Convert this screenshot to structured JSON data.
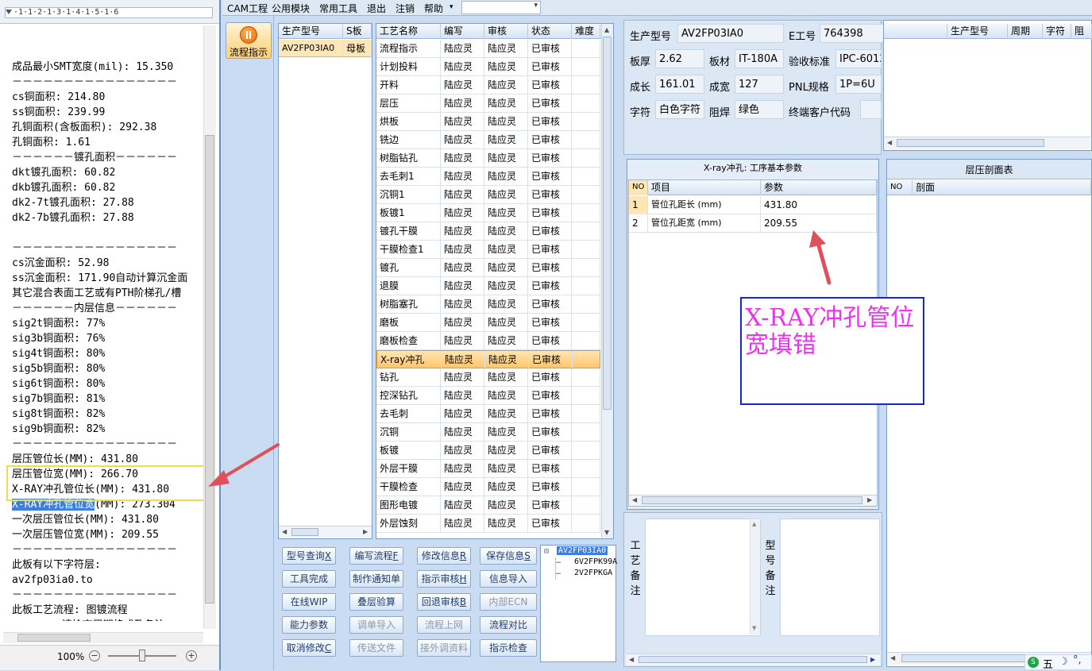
{
  "editor": {
    "ruler": "·1·1·2·1·3·1·4·1·5·1·6",
    "lines": [
      "",
      "成品最小SMT宽度(mil): 15.350",
      "－－－－－－－－－－－－－－－－",
      "cs铜面积: 214.80",
      "ss铜面积: 239.99",
      "孔铜面积(含板面积): 292.38",
      "孔铜面积: 1.61",
      "－－－－－－镀孔面积－－－－－－",
      "dkt镀孔面积: 60.82",
      "dkb镀孔面积: 60.82",
      "dk2-7t镀孔面积: 27.88",
      "dk2-7b镀孔面积: 27.88",
      "",
      "－－－－－－－－－－－－－－－－",
      "cs沉金面积: 52.98",
      "ss沉金面积: 171.90自动计算沉金面",
      "其它混合表面工艺或有PTH阶梯孔/槽",
      "－－－－－－内层信息－－－－－－",
      "sig2t铜面积: 77%",
      "sig3b铜面积: 76%",
      "sig4t铜面积: 80%",
      "sig5b铜面积: 80%",
      "sig6t铜面积: 80%",
      "sig7b铜面积: 81%",
      "sig8t铜面积: 82%",
      "sig9b铜面积: 82%",
      "－－－－－－－－－－－－－－－－",
      "层压管位长(MM): 431.80",
      "层压管位宽(MM): 266.70",
      "X-RAY冲孔管位长(MM): 431.80",
      "",
      "一次层压管位长(MM): 431.80",
      "一次层压管位宽(MM): 209.55",
      "－－－－－－－－－－－－－－－－",
      "此板有以下字符层:",
      "av2fp03ia0.to",
      "－－－－－－－－－－－－－－－－",
      "此板工艺流程: 图镀流程",
      "<<<<<<<_请检查周期格式及备注_>>"
    ],
    "selected_line_sel": "X-RAY冲孔管位宽",
    "selected_line_rest": "(MM): 273.304",
    "zoom": "100%",
    "zoom_minus": "−",
    "zoom_plus": "+"
  },
  "menu": {
    "items": [
      "CAM工程",
      "公用模块",
      "常用工具",
      "退出",
      "注销",
      "帮助"
    ],
    "dropdown_arrow": "▾"
  },
  "flow_button": {
    "label": "流程指示"
  },
  "model_grid": {
    "headers": [
      "生产型号",
      "S板"
    ],
    "row": [
      "AV2FP03IA0",
      "母板"
    ]
  },
  "process_grid": {
    "headers": [
      "工艺名称",
      "编写",
      "审核",
      "状态",
      "难度"
    ],
    "rows": [
      [
        "流程指示",
        "陆应灵",
        "陆应灵",
        "已审核"
      ],
      [
        "计划投料",
        "陆应灵",
        "陆应灵",
        "已审核"
      ],
      [
        "开料",
        "陆应灵",
        "陆应灵",
        "已审核"
      ],
      [
        "层压",
        "陆应灵",
        "陆应灵",
        "已审核"
      ],
      [
        "烘板",
        "陆应灵",
        "陆应灵",
        "已审核"
      ],
      [
        "铣边",
        "陆应灵",
        "陆应灵",
        "已审核"
      ],
      [
        "树脂钻孔",
        "陆应灵",
        "陆应灵",
        "已审核"
      ],
      [
        "去毛刺1",
        "陆应灵",
        "陆应灵",
        "已审核"
      ],
      [
        "沉铜1",
        "陆应灵",
        "陆应灵",
        "已审核"
      ],
      [
        "板镀1",
        "陆应灵",
        "陆应灵",
        "已审核"
      ],
      [
        "镀孔干膜",
        "陆应灵",
        "陆应灵",
        "已审核"
      ],
      [
        "干膜检查1",
        "陆应灵",
        "陆应灵",
        "已审核"
      ],
      [
        "镀孔",
        "陆应灵",
        "陆应灵",
        "已审核"
      ],
      [
        "退膜",
        "陆应灵",
        "陆应灵",
        "已审核"
      ],
      [
        "树脂塞孔",
        "陆应灵",
        "陆应灵",
        "已审核"
      ],
      [
        "磨板",
        "陆应灵",
        "陆应灵",
        "已审核"
      ],
      [
        "磨板检查",
        "陆应灵",
        "陆应灵",
        "已审核"
      ],
      [
        "X-ray冲孔",
        "陆应灵",
        "陆应灵",
        "已审核"
      ],
      [
        "钻孔",
        "陆应灵",
        "陆应灵",
        "已审核"
      ],
      [
        "控深钻孔",
        "陆应灵",
        "陆应灵",
        "已审核"
      ],
      [
        "去毛刺",
        "陆应灵",
        "陆应灵",
        "已审核"
      ],
      [
        "沉铜",
        "陆应灵",
        "陆应灵",
        "已审核"
      ],
      [
        "板镀",
        "陆应灵",
        "陆应灵",
        "已审核"
      ],
      [
        "外层干膜",
        "陆应灵",
        "陆应灵",
        "已审核"
      ],
      [
        "干膜检查",
        "陆应灵",
        "陆应灵",
        "已审核"
      ],
      [
        "图形电镀",
        "陆应灵",
        "陆应灵",
        "已审核"
      ],
      [
        "外层蚀刻",
        "陆应灵",
        "陆应灵",
        "已审核"
      ]
    ],
    "selected_index": 17
  },
  "buttons": [
    {
      "label": "型号查询",
      "key": "X",
      "disabled": false
    },
    {
      "label": "编写流程",
      "key": "F",
      "disabled": false
    },
    {
      "label": "修改信息",
      "key": "R",
      "disabled": false
    },
    {
      "label": "保存信息",
      "key": "S",
      "disabled": false
    },
    {
      "label": "工具完成",
      "key": "",
      "disabled": false
    },
    {
      "label": "制作通知单",
      "key": "",
      "disabled": false
    },
    {
      "label": "指示审核",
      "key": "H",
      "disabled": false
    },
    {
      "label": "信息导入",
      "key": "",
      "disabled": false
    },
    {
      "label": "在线WIP",
      "key": "",
      "disabled": false
    },
    {
      "label": "叠层验算",
      "key": "",
      "disabled": false
    },
    {
      "label": "回退审核",
      "key": "B",
      "disabled": false
    },
    {
      "label": "内部ECN",
      "key": "",
      "disabled": true
    },
    {
      "label": "能力参数",
      "key": "",
      "disabled": false
    },
    {
      "label": "调单导入",
      "key": "",
      "disabled": true
    },
    {
      "label": "流程上网",
      "key": "",
      "disabled": true
    },
    {
      "label": "流程对比",
      "key": "",
      "disabled": false
    },
    {
      "label": "取消修改",
      "key": "C",
      "disabled": false
    },
    {
      "label": "传送文件",
      "key": "",
      "disabled": true
    },
    {
      "label": "接外调资料",
      "key": "",
      "disabled": true
    },
    {
      "label": "指示检查",
      "key": "",
      "disabled": false
    }
  ],
  "tree": {
    "root": "AV2FP03IA0",
    "children": [
      "6V2FPK99A",
      "2V2FPKGA"
    ]
  },
  "info": {
    "model_label": "生产型号",
    "model_value": "AV2FP03IA0",
    "eng_label": "E工号",
    "eng_value": "764398",
    "thickness_label": "板厚",
    "thickness_value": "2.62",
    "material_label": "板材",
    "material_value": "IT-180A",
    "standard_label": "验收标准",
    "standard_value": "IPC-6012",
    "length_label": "成长",
    "length_value": "161.01",
    "width_label": "成宽",
    "width_value": "127",
    "pnl_label": "PNL规格",
    "pnl_value": "1P=6U",
    "char_label": "字符",
    "char_value": "白色字符",
    "mask_label": "阻焊",
    "mask_value": "绿色",
    "endcode_label": "终端客户代码",
    "endcode_value": ""
  },
  "topright_grid": {
    "headers": [
      "生产型号",
      "周期",
      "字符",
      "阻"
    ]
  },
  "xray": {
    "title": "X-ray冲孔: 工序基本参数",
    "headers": [
      "NO",
      "项目",
      "参数"
    ],
    "rows": [
      [
        "1",
        "管位孔距长 (mm)",
        "431.80"
      ],
      [
        "2",
        "管位孔距宽 (mm)",
        "209.55"
      ]
    ]
  },
  "layer": {
    "title": "层压剖面表",
    "headers": [
      "NO",
      "剖面"
    ]
  },
  "callout": {
    "text": "X-RAY冲孔管位宽填错"
  },
  "notes": {
    "process_label": "工艺备注",
    "model_label": "型号备注"
  },
  "ime": {
    "text": "五"
  },
  "colors": {
    "arrow": "#e0505a",
    "callout_border": "#1a26c9",
    "callout_text": "#ee33ee",
    "selection": "#3d7ee0",
    "highlight_box": "#e8e04a"
  }
}
